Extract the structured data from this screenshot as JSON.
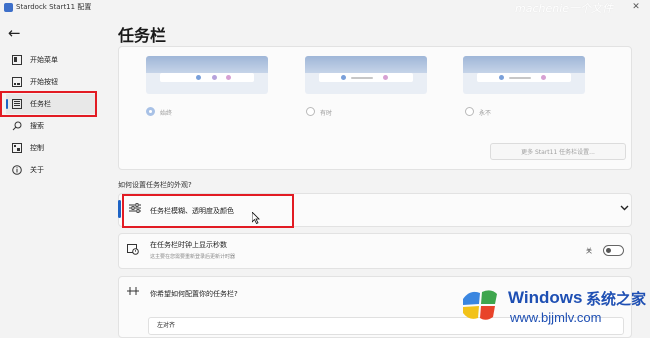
{
  "window": {
    "title": "Stardock Start11 配置",
    "close_glyph": "✕"
  },
  "watermark_top": "machenie一个文件",
  "sidebar": {
    "back_glyph": "←",
    "items": [
      {
        "label": "开始菜单",
        "icon": "start-menu-icon"
      },
      {
        "label": "开始按钮",
        "icon": "start-button-icon"
      },
      {
        "label": "任务栏",
        "icon": "taskbar-icon",
        "active": true
      },
      {
        "label": "搜索",
        "icon": "search-icon"
      },
      {
        "label": "控制",
        "icon": "control-icon"
      },
      {
        "label": "关于",
        "icon": "info-icon"
      }
    ]
  },
  "main": {
    "title": "任务栏",
    "preview_options": [
      {
        "label": "始终",
        "selected": true
      },
      {
        "label": "有时",
        "selected": false
      },
      {
        "label": "永不",
        "selected": false
      }
    ],
    "more_settings_button": "更多 Start11 任务栏设置...",
    "appearance_heading": "如何设置任务栏的外观?",
    "rows": {
      "blur": {
        "label": "任务栏模糊、透明度及颜色",
        "expanded": false
      },
      "seconds": {
        "label": "在任务栏时钟上显示秒数",
        "sub": "这主要在您需要重新登录后更新计时器",
        "toggle_label": "关",
        "toggle_on": false
      },
      "configure": {
        "label": "你希望如何配置你的任务栏?"
      }
    },
    "alignment_select": "左对齐"
  },
  "brand_watermark": {
    "name": "Windows",
    "cn": "系统之家",
    "url": "www.bjjmlv.com"
  },
  "colors": {
    "accent": "#1d63c5",
    "highlight": "#e21b23",
    "watermark": "#1e4fb3"
  }
}
